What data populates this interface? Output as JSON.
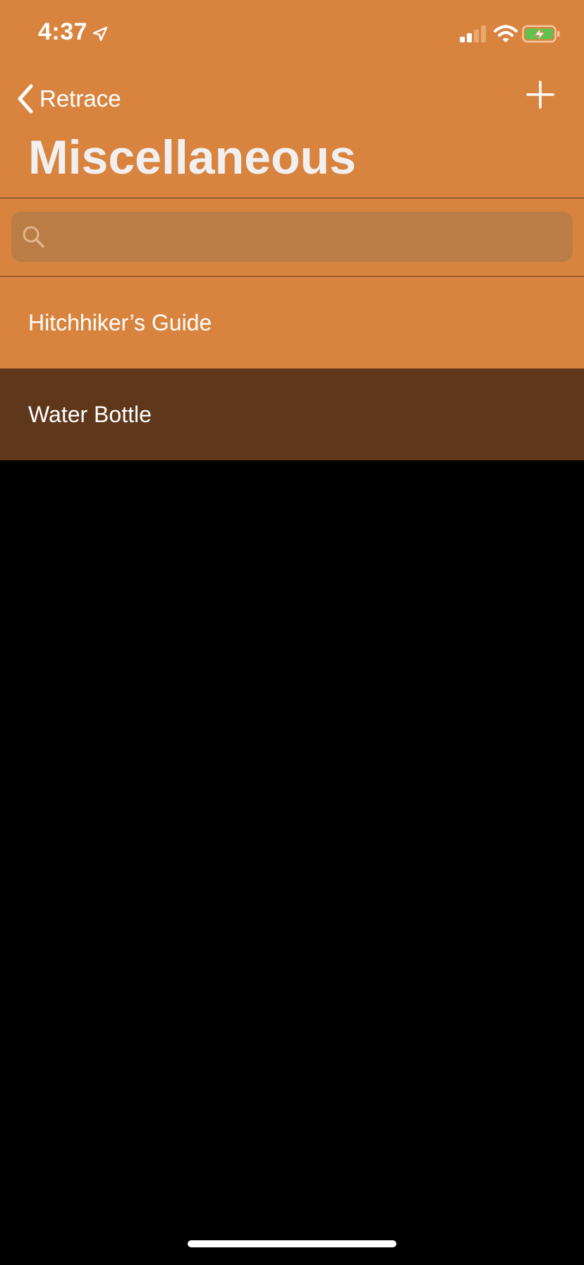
{
  "status_bar": {
    "time": "4:37",
    "icons": [
      "location-arrow-icon",
      "cellular-signal-icon",
      "wifi-icon",
      "battery-charging-icon"
    ]
  },
  "nav": {
    "back_label": "Retrace",
    "back_icon": "chevron-left-icon",
    "add_icon": "plus-icon",
    "title": "Miscellaneous"
  },
  "search": {
    "icon": "search-icon",
    "placeholder": "",
    "value": ""
  },
  "list": {
    "items": [
      {
        "label": "Hitchhiker’s Guide",
        "state": "normal"
      },
      {
        "label": "Water Bottle",
        "state": "selected"
      }
    ]
  },
  "colors": {
    "accent": "#D8843F",
    "selected_row": "#5F381B",
    "search_field": "#BA7D45",
    "background": "#000000",
    "title_text": "#F1EFEF"
  }
}
